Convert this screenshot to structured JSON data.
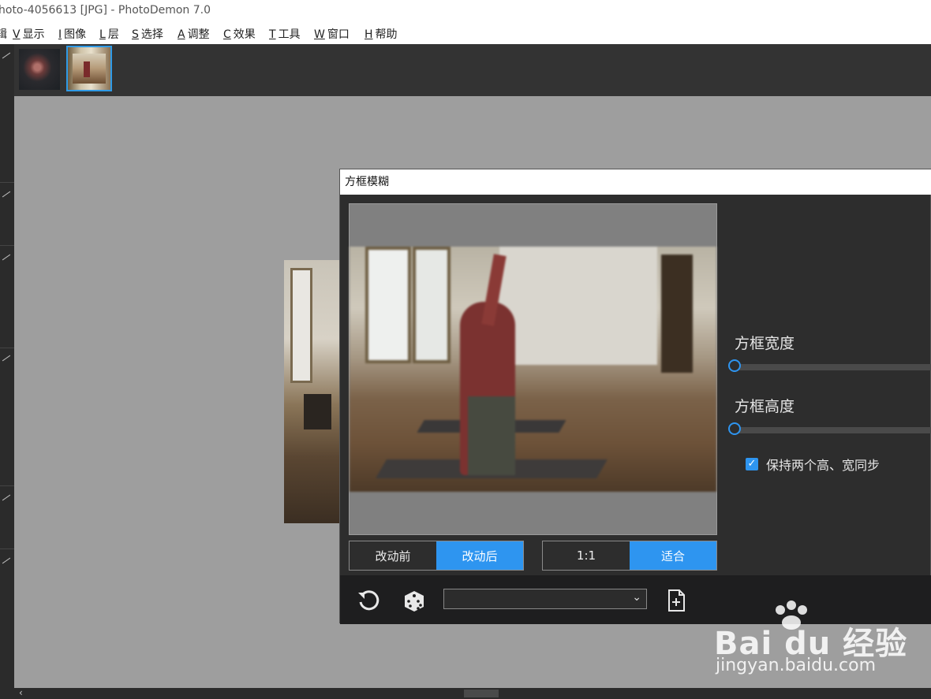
{
  "window": {
    "title": "hoto-4056613 [JPG]  -  PhotoDemon 7.0"
  },
  "menu": [
    {
      "key": "",
      "label": "辑"
    },
    {
      "key": "V",
      "label": "显示"
    },
    {
      "key": "I",
      "label": "图像"
    },
    {
      "key": "L",
      "label": "层"
    },
    {
      "key": "S",
      "label": "选择"
    },
    {
      "key": "A",
      "label": "调整"
    },
    {
      "key": "C",
      "label": "效果"
    },
    {
      "key": "T",
      "label": "工具"
    },
    {
      "key": "W",
      "label": "窗口"
    },
    {
      "key": "H",
      "label": "帮助"
    }
  ],
  "dialog": {
    "title": "方框模糊",
    "before_label": "改动前",
    "after_label": "改动后",
    "zoom_1to1_label": "1:1",
    "fit_label": "适合",
    "width_label": "方框宽度",
    "height_label": "方框高度",
    "width_value": 0,
    "height_value": 0,
    "sync_checkbox_label": "保持两个高、宽同步",
    "sync_checked": true,
    "preset_value": "",
    "active_view": "改动后",
    "active_zoom": "适合"
  },
  "watermark": {
    "brand": "Bai du 经验",
    "url": "jingyan.baidu.com"
  },
  "colors": {
    "accent": "#2e95f0",
    "dialog_bg": "#2d2d2d",
    "canvas_bg": "#9e9e9e"
  }
}
